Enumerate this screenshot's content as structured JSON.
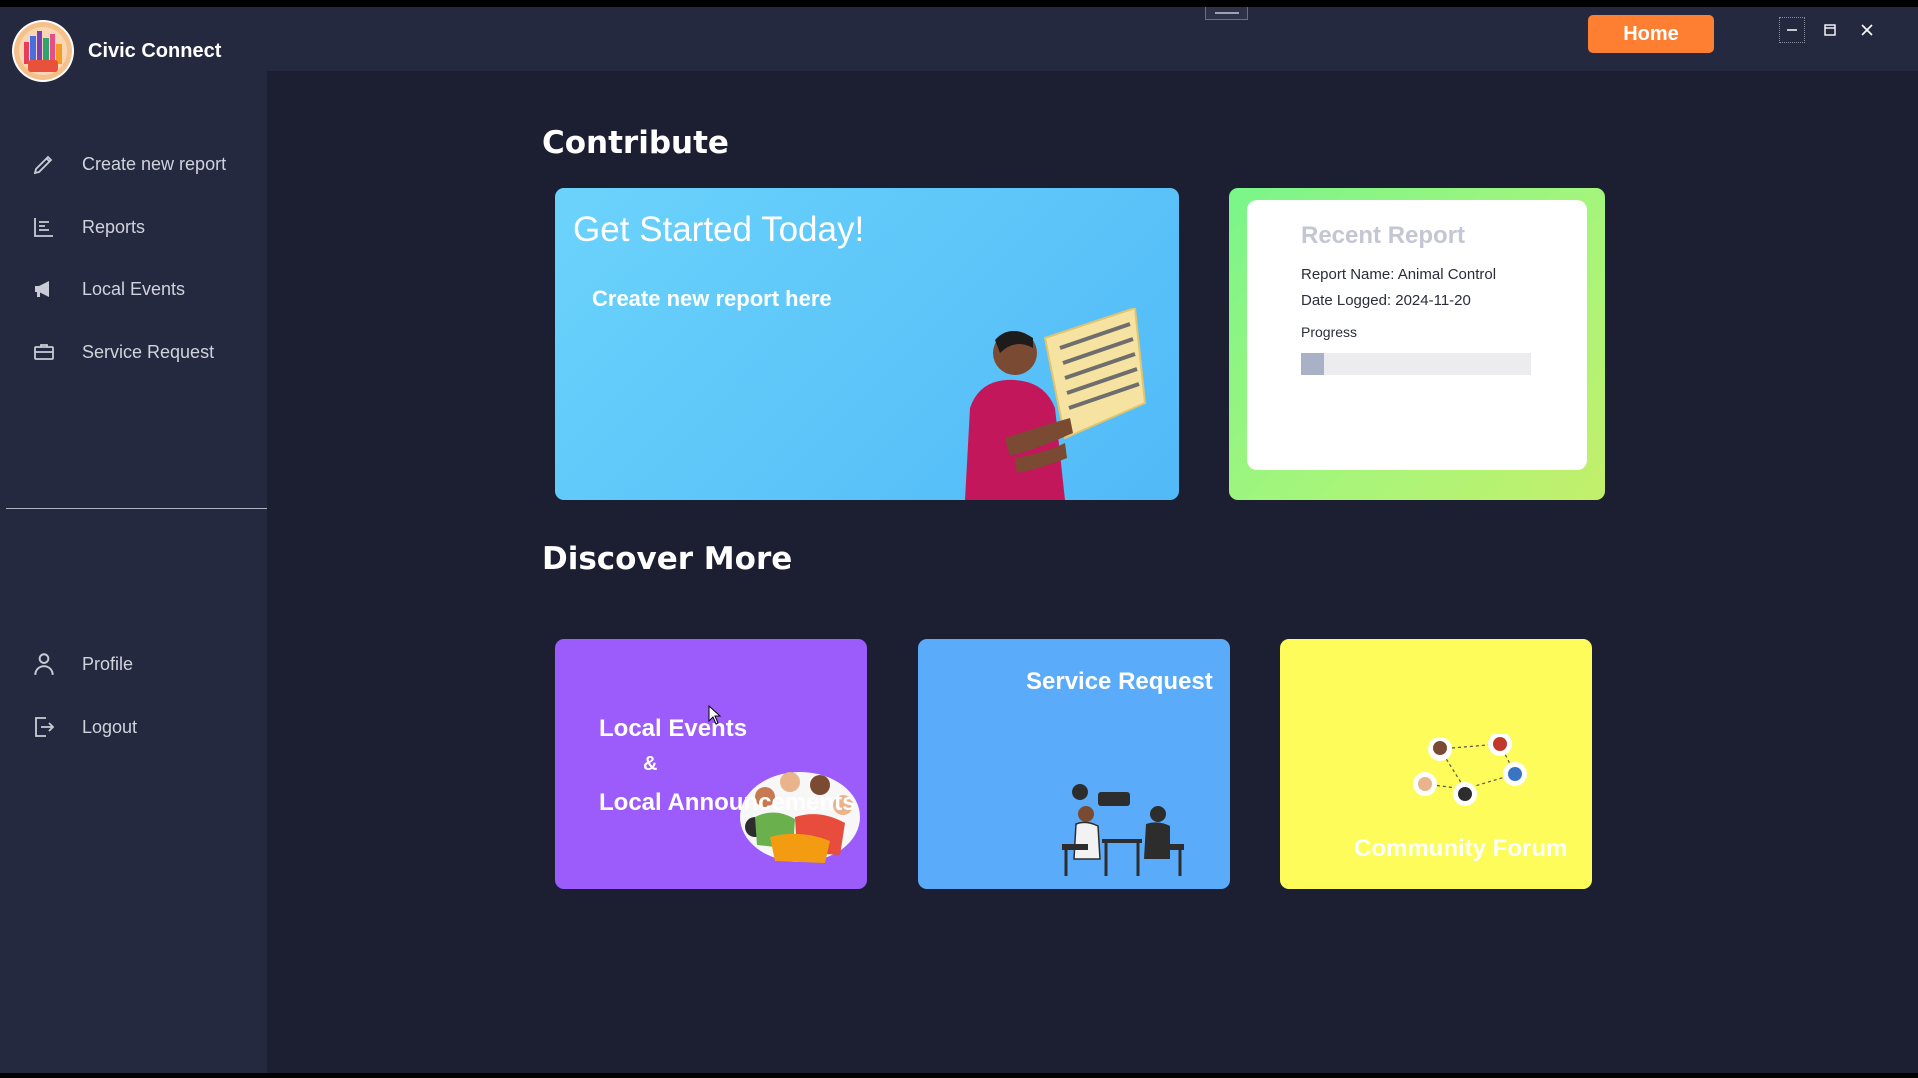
{
  "app": {
    "name": "Civic Connect",
    "logo_text": "CIVIC CONNECT"
  },
  "sidebar": {
    "items": [
      {
        "label": "Create new report",
        "icon": "pencil-icon"
      },
      {
        "label": "Reports",
        "icon": "list-icon"
      },
      {
        "label": "Local Events",
        "icon": "megaphone-icon"
      },
      {
        "label": "Service Request",
        "icon": "briefcase-icon"
      }
    ],
    "bottom_items": [
      {
        "label": "Profile",
        "icon": "person-icon"
      },
      {
        "label": "Logout",
        "icon": "logout-icon"
      }
    ]
  },
  "topbar": {
    "home_label": "Home",
    "window_controls": [
      "minimize-icon",
      "maximize-icon",
      "close-icon"
    ]
  },
  "contribute": {
    "title": "Contribute",
    "get_started": {
      "title": "Get Started Today!",
      "subtitle": "Create new report here"
    },
    "recent_report": {
      "title": "Recent Report",
      "report_name": "Report Name: Animal Control",
      "date_logged": "Date Logged: 2024-11-20",
      "progress_label": "Progress",
      "progress_value": 0.1
    }
  },
  "discover": {
    "title": "Discover More",
    "cards": {
      "events": {
        "line1": "Local Events",
        "line2": "&",
        "line3": "Local Announcements"
      },
      "service": {
        "label": "Service Request"
      },
      "forum": {
        "label": "Community Forum"
      }
    }
  },
  "colors": {
    "background": "#1c1f31",
    "sidebar": "#25293f",
    "accent": "#ff7f32",
    "get_started_card": "#5ac4f9",
    "events_card": "#9b5cfb",
    "service_card": "#5aabfa",
    "forum_card": "#fdfc5a"
  }
}
